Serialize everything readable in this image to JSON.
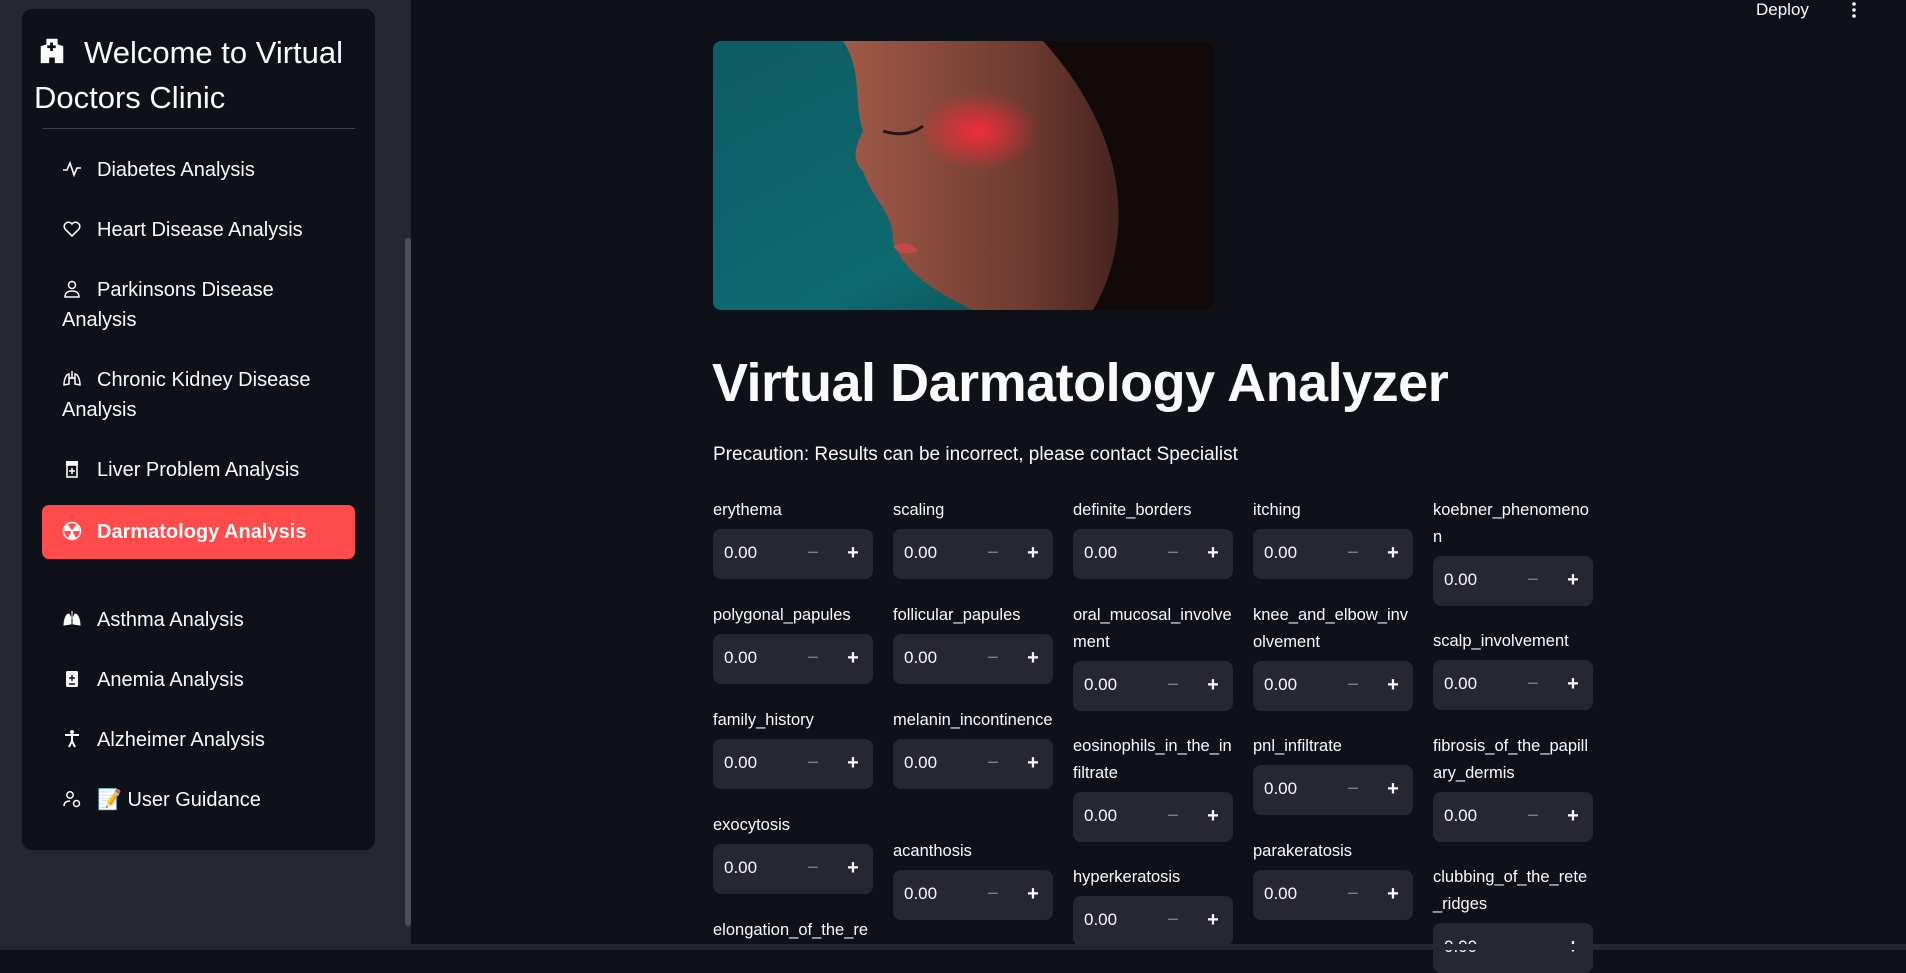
{
  "sidebar": {
    "title": "Welcome to Virtual Doctors Clinic",
    "logo_icon": "hospital-icon",
    "items": [
      {
        "label": "Diabetes Analysis",
        "icon": "activity-icon",
        "active": false
      },
      {
        "label": "Heart Disease Analysis",
        "icon": "heart-icon",
        "active": false
      },
      {
        "label": "Parkinsons Disease Analysis",
        "icon": "person-icon",
        "active": false
      },
      {
        "label": "Chronic Kidney Disease Analysis",
        "icon": "lungs-icon",
        "active": false
      },
      {
        "label": "Liver Problem Analysis",
        "icon": "prescription-icon",
        "active": false
      },
      {
        "label": "Darmatology Analysis",
        "icon": "radioactive-icon",
        "active": true
      },
      {
        "label": "Asthma Analysis",
        "icon": "lungs-fill-icon",
        "active": false
      },
      {
        "label": "Anemia Analysis",
        "icon": "file-medical-icon",
        "active": false
      },
      {
        "label": "Alzheimer Analysis",
        "icon": "universal-access-icon",
        "active": false
      },
      {
        "label": "📝 User Guidance",
        "icon": "person-gear-icon",
        "active": false
      }
    ]
  },
  "topbar": {
    "deploy_label": "Deploy",
    "menu_icon": "more-vertical-icon"
  },
  "main": {
    "title": "Virtual Darmatology Analyzer",
    "precaution": "Precaution: Results can be incorrect, please contact Specialist",
    "hero_image": "face-with-skin-rash-image",
    "minus_label": "−",
    "plus_label": "+",
    "fields": [
      {
        "label": "erythema",
        "value": "0.00"
      },
      {
        "label": "scaling",
        "value": "0.00"
      },
      {
        "label": "definite_borders",
        "value": "0.00"
      },
      {
        "label": "itching",
        "value": "0.00"
      },
      {
        "label": "koebner_phenomenon",
        "value": "0.00"
      },
      {
        "label": "polygonal_papules",
        "value": "0.00"
      },
      {
        "label": "follicular_papules",
        "value": "0.00"
      },
      {
        "label": "oral_mucosal_involvement",
        "value": "0.00"
      },
      {
        "label": "knee_and_elbow_involvement",
        "value": "0.00"
      },
      {
        "label": "scalp_involvement",
        "value": "0.00"
      },
      {
        "label": "family_history",
        "value": "0.00"
      },
      {
        "label": "melanin_incontinence",
        "value": "0.00"
      },
      {
        "label": "eosinophils_in_the_infiltrate",
        "value": "0.00"
      },
      {
        "label": "pnl_infiltrate",
        "value": "0.00"
      },
      {
        "label": "fibrosis_of_the_papillary_dermis",
        "value": "0.00"
      },
      {
        "label": "exocytosis",
        "value": "0.00"
      },
      {
        "label": "acanthosis",
        "value": "0.00"
      },
      {
        "label": "hyperkeratosis",
        "value": "0.00"
      },
      {
        "label": "parakeratosis",
        "value": "0.00"
      },
      {
        "label": "clubbing_of_the_rete_ridges",
        "value": "0.00"
      },
      {
        "label": "elongation_of_the_re",
        "value": ""
      }
    ]
  }
}
